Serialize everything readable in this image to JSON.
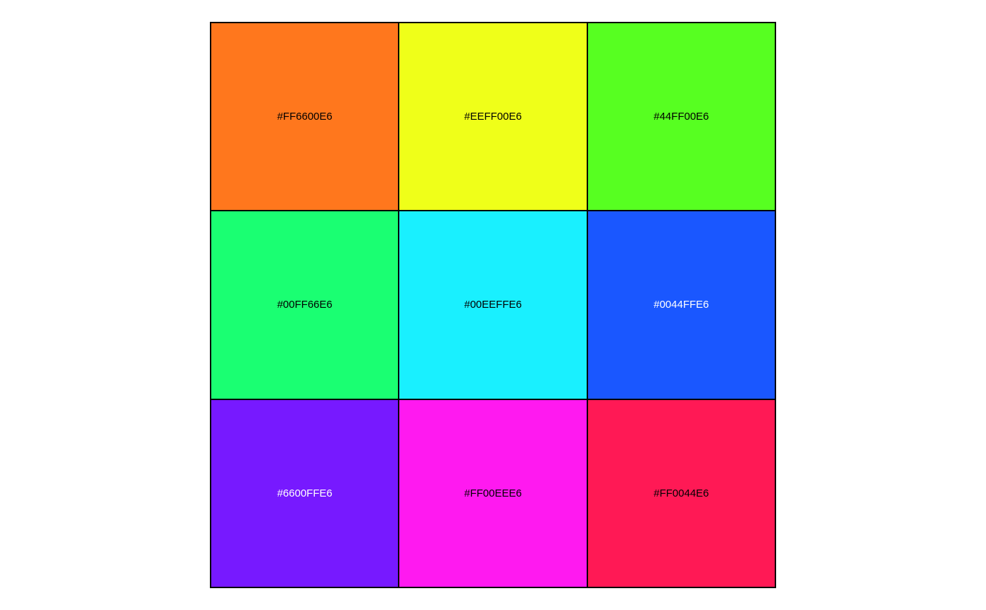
{
  "swatches": [
    {
      "label": "#FF6600E6",
      "color": "#FF771D",
      "text_color": "#000000"
    },
    {
      "label": "#EEFF00E6",
      "color": "#EFFF19",
      "text_color": "#000000"
    },
    {
      "label": "#44FF00E6",
      "color": "#57FF21",
      "text_color": "#000000"
    },
    {
      "label": "#00FF66E6",
      "color": "#1AFF72",
      "text_color": "#000000"
    },
    {
      "label": "#00EEFFE6",
      "color": "#19F0FF",
      "text_color": "#000000"
    },
    {
      "label": "#0044FFE6",
      "color": "#1A57FF",
      "text_color": "#FFFFFF"
    },
    {
      "label": "#6600FFE6",
      "color": "#7719FF",
      "text_color": "#FFFFFF"
    },
    {
      "label": "#FF00EEE6",
      "color": "#FF19F0",
      "text_color": "#000000"
    },
    {
      "label": "#FF0044E6",
      "color": "#FF1955",
      "text_color": "#000000"
    }
  ]
}
